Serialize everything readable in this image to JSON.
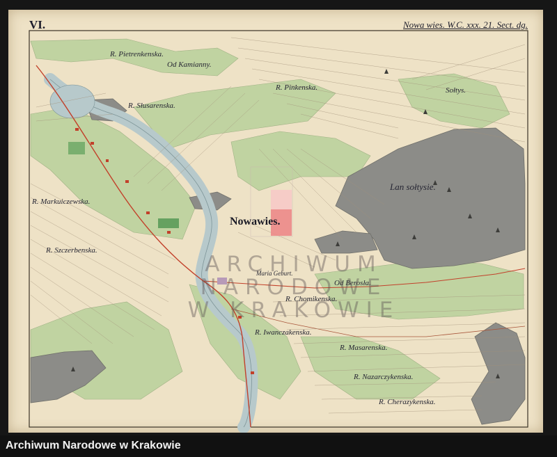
{
  "sheet": {
    "number": "VI.",
    "title": "Nowa wies. W.C. xxx. 21. Sect. dg."
  },
  "places": {
    "nowawies": "Nowawies.",
    "lan_soltysie": "Lan sołtysie.",
    "soltys": "Sołtys.",
    "od_kamianny": "Od Kamianny.",
    "r_pietrenkenska": "R. Pietrenkenska.",
    "r_pinkenska": "R. Pinkenska.",
    "r_slusarenska": "R. Słusarenska.",
    "r_markuiczewska": "R. Markuiczewska.",
    "r_szczerbenska": "R. Szczerbenska.",
    "maria_geburt": "Maria Geburt.",
    "od_berosla": "Od Berosła.",
    "r_chomikenska": "R. Chomikenska.",
    "r_iwanczakenska": "R. Iwanczakenska.",
    "r_masarenska": "R. Masarenska.",
    "r_nazarczykenska": "R. Nazarczykenska.",
    "r_cherazykenska": "R. Cherazykenska."
  },
  "watermark": {
    "line1": "ARCHIWUM NARODOWE",
    "line2": "W KRAKOWIE"
  },
  "footer": {
    "archive_label": "Archiwum Narodowe w Krakowie"
  },
  "colors": {
    "paper": "#eee2c6",
    "meadow": "#bed3a0",
    "forest": "#8c8c88",
    "river": "#b7c9cb",
    "road_red": "#c2402a",
    "highlight_red": "#ec8a88",
    "highlight_light": "#f6cac6"
  }
}
